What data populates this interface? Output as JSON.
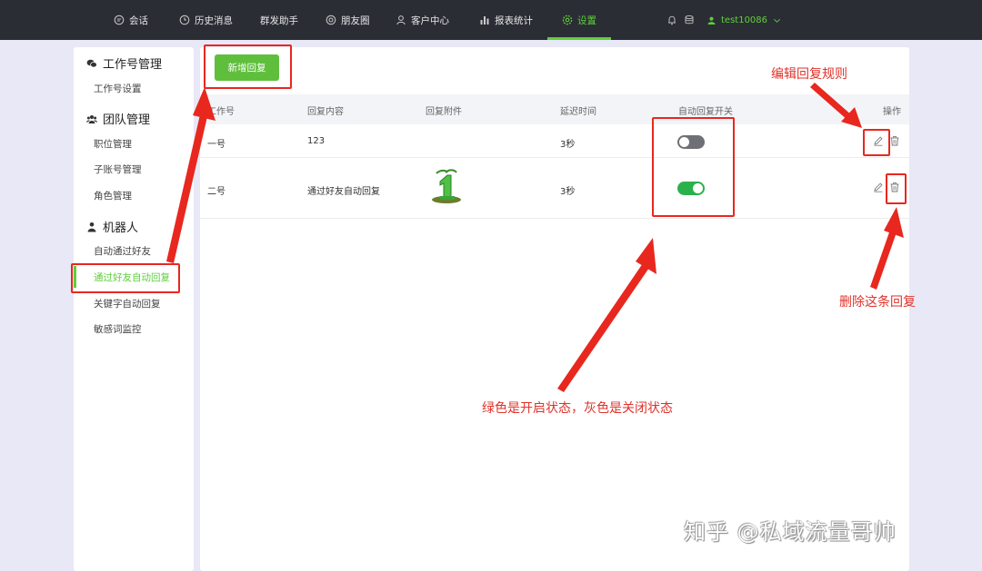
{
  "topnav": {
    "items": [
      {
        "label": "会话",
        "icon": "chat-icon"
      },
      {
        "label": "历史消息",
        "icon": "clock-icon"
      },
      {
        "label": "群发助手",
        "icon": ""
      },
      {
        "label": "朋友圈",
        "icon": "camera-icon"
      },
      {
        "label": "客户中心",
        "icon": "user-icon"
      },
      {
        "label": "报表统计",
        "icon": "bar-chart-icon"
      },
      {
        "label": "设置",
        "icon": "gear-icon"
      }
    ],
    "active": "设置",
    "username": "test10086"
  },
  "sidebar": {
    "groups": [
      {
        "label": "工作号管理",
        "icon": "wechat-icon",
        "items": [
          "工作号设置"
        ]
      },
      {
        "label": "团队管理",
        "icon": "team-icon",
        "items": [
          "职位管理",
          "子账号管理",
          "角色管理"
        ]
      },
      {
        "label": "机器人",
        "icon": "robot-icon",
        "items": [
          "自动通过好友",
          "通过好友自动回复",
          "关键字自动回复",
          "敏感词监控"
        ]
      }
    ],
    "active_item": "通过好友自动回复"
  },
  "toolbar": {
    "add_label": "新增回复"
  },
  "table": {
    "headers": [
      "工作号",
      "回复内容",
      "回复附件",
      "延迟时间",
      "自动回复开关",
      "操作"
    ],
    "rows": [
      {
        "account": "一号",
        "content": "123",
        "attachment": "",
        "delay": "3秒",
        "enabled": false
      },
      {
        "account": "二号",
        "content": "通过好友自动回复",
        "attachment": "green-figure-image",
        "delay": "3秒",
        "enabled": true
      }
    ]
  },
  "annotations": {
    "edit_rule": "编辑回复规则",
    "delete_reply": "删除这条回复",
    "toggle_note": "绿色是开启状态，灰色是关闭状态"
  },
  "watermark": "知乎 @私域流量哥帅",
  "colors": {
    "accent": "#5fcf3c",
    "toggle_on": "#2bb14c",
    "toggle_off": "#6f7075",
    "annotation": "#e8271f",
    "nav_bg": "#2b2d35"
  }
}
